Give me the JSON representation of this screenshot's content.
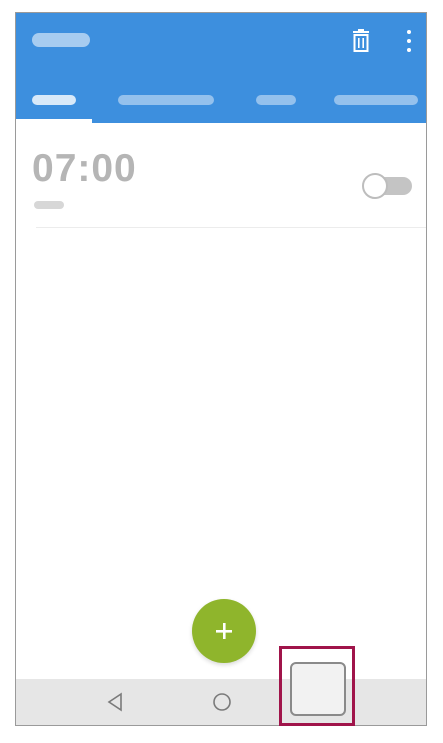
{
  "alarm": {
    "time": "07:00",
    "enabled": false
  },
  "icons": {
    "delete": "trash-icon",
    "more": "more-vert-icon",
    "add": "plus-icon",
    "back": "back-triangle-icon",
    "home": "home-circle-icon",
    "recents": "recents-square-icon"
  },
  "fab": {
    "label": "+"
  },
  "colors": {
    "appbar": "#3d8fde",
    "fab": "#8fb52c",
    "highlight": "#a0144a"
  }
}
